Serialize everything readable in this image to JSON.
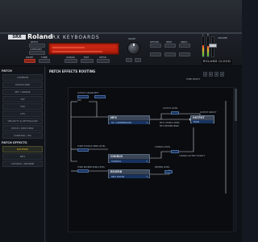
{
  "header": {
    "logo_box": "SRX",
    "brand": "Roland",
    "model": "SRX KEYBOARDS",
    "button_labels": {
      "patch_name": "PATCH",
      "category": "CATEGORY",
      "write": "WRITE",
      "tone": "TONE",
      "assign": "ASSIGN",
      "edit": "EDIT",
      "setup": "SETUP",
      "option": "OPTION",
      "help": "HELP",
      "undo": "UNDO"
    },
    "knob_label": "VALUE",
    "meter_labels": [
      "L",
      "R"
    ],
    "volume_label": "VOLUME",
    "plate": "ROLAND CLOUD"
  },
  "sidebar": {
    "heading": "PATCH",
    "items": [
      {
        "label": "COMMON",
        "active": false
      },
      {
        "label": "STRUCTURE",
        "active": false
      },
      {
        "label": "KEY / RANGE",
        "active": false
      },
      {
        "label": "TVF",
        "active": false
      },
      {
        "label": "TVA",
        "active": false
      },
      {
        "label": "LFO",
        "active": false
      },
      {
        "label": "VELOCITY & KEYFOLLOW",
        "active": false
      },
      {
        "label": "PITCH / PITCH ENV",
        "active": false
      },
      {
        "label": "CONTROL / EG",
        "active": false
      }
    ],
    "heading2": "PATCH EFFECTS",
    "items2": [
      {
        "label": "ROUTING",
        "active": true
      },
      {
        "label": "MFX",
        "active": false
      },
      {
        "label": "CHORUS / REVERB",
        "active": false
      }
    ]
  },
  "main": {
    "title": "PATCH EFFECTS ROUTING",
    "tone_label": "TONE SELECT",
    "tone_buttons": [
      "1",
      "2",
      "3",
      "4"
    ]
  },
  "routing": {
    "lbl_top1": "OUTPUT ASSIGN",
    "lbl_top2": "MFX",
    "lbl_dry": "DRY",
    "lbl_output_level": "OUTPUT LEVEL",
    "lbl_mfx_chorus_send": "MFX CHORUS SEND",
    "lbl_mfx_reverb_send": "MFX REVERB SEND",
    "lbl_output_select": "OUTPUT SELECT",
    "lbl_tone_chorus": "TONE CHORUS SEND LEVEL",
    "lbl_tone_reverb": "TONE REVERB SEND LEVEL",
    "lbl_chorus_level": "CHORUS LEVEL",
    "lbl_chorus_output": "CHORUS OUTPUT SELECT",
    "lbl_reverb_level": "REVERB LEVEL",
    "mfx": {
      "title": "MFX",
      "value": "01: COMPRESSOR"
    },
    "chorus": {
      "title": "CHORUS",
      "value": "CHORUS"
    },
    "reverb": {
      "title": "REVERB",
      "value": "REV: ROOM"
    },
    "output": {
      "title": "OUTPUT",
      "value": "MAIN"
    }
  }
}
